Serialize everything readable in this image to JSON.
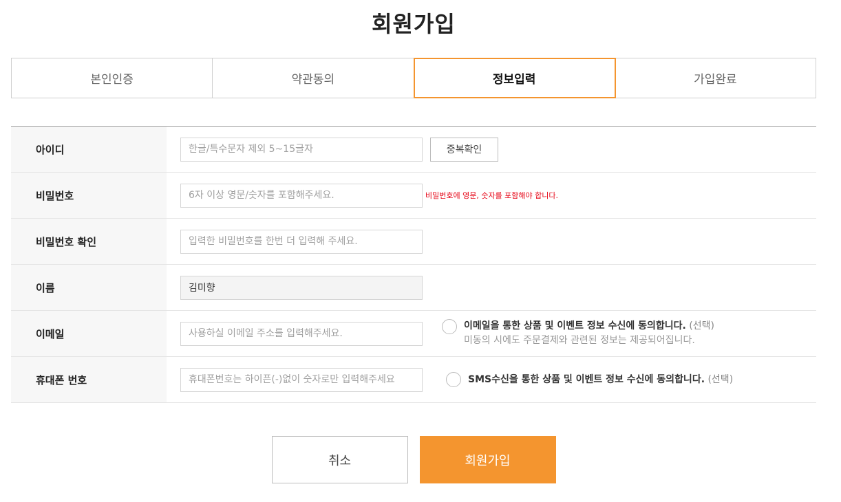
{
  "page": {
    "title": "회원가입"
  },
  "steps": [
    {
      "label": "본인인증",
      "active": false
    },
    {
      "label": "약관동의",
      "active": false
    },
    {
      "label": "정보입력",
      "active": true
    },
    {
      "label": "가입완료",
      "active": false
    }
  ],
  "form": {
    "id": {
      "label": "아이디",
      "placeholder": "한글/특수문자 제외 5~15글자",
      "value": "",
      "check_button": "중복확인"
    },
    "password": {
      "label": "비밀번호",
      "placeholder": "6자 이상 영문/숫자를 포함해주세요.",
      "value": "",
      "error": "비밀번호에 영문, 숫자를 포함해야 합니다."
    },
    "password_confirm": {
      "label": "비밀번호 확인",
      "placeholder": "입력한 비밀번호를 한번 더 입력해 주세요.",
      "value": ""
    },
    "name": {
      "label": "이름",
      "value": "김미향"
    },
    "email": {
      "label": "이메일",
      "placeholder": "사용하실 이메일 주소를 입력해주세요.",
      "value": "",
      "consent_main": "이메일을 통한 상품 및 이벤트 정보 수신에 동의합니다.",
      "consent_opt": "(선택)",
      "consent_sub": "미동의 시에도 주문결제와 관련된 정보는 제공되어집니다."
    },
    "phone": {
      "label": "휴대폰 번호",
      "placeholder": "휴대폰번호는 하이픈(-)없이 숫자로만 입력해주세요",
      "value": "",
      "consent_main": "SMS수신을 통한 상품 및 이벤트 정보 수신에 동의합니다.",
      "consent_opt": "(선택)"
    }
  },
  "buttons": {
    "cancel": "취소",
    "submit": "회원가입"
  },
  "colors": {
    "accent": "#f4952f",
    "error": "#e60012"
  }
}
